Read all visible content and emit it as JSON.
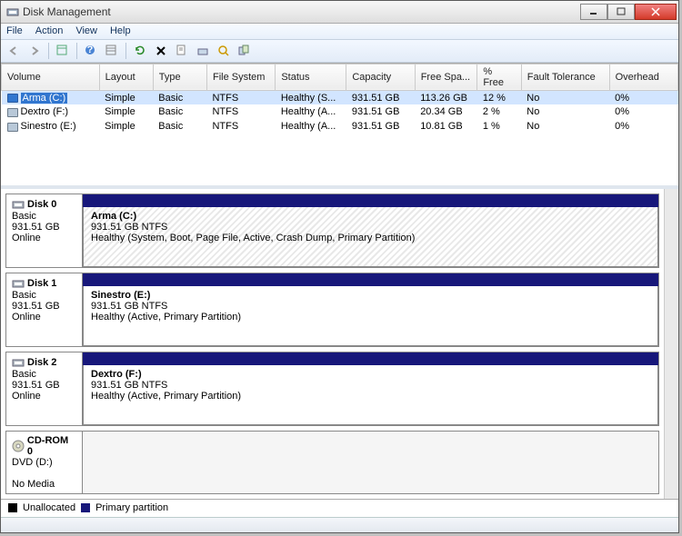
{
  "title": "Disk Management",
  "menu": {
    "file": "File",
    "action": "Action",
    "view": "View",
    "help": "Help"
  },
  "columns": [
    "Volume",
    "Layout",
    "Type",
    "File System",
    "Status",
    "Capacity",
    "Free Spa...",
    "% Free",
    "Fault Tolerance",
    "Overhead"
  ],
  "volumes": [
    {
      "name": "Arma (C:)",
      "layout": "Simple",
      "type": "Basic",
      "fs": "NTFS",
      "status": "Healthy (S...",
      "capacity": "931.51 GB",
      "free": "113.26 GB",
      "pct": "12 %",
      "ft": "No",
      "oh": "0%",
      "selected": true
    },
    {
      "name": "Dextro (F:)",
      "layout": "Simple",
      "type": "Basic",
      "fs": "NTFS",
      "status": "Healthy (A...",
      "capacity": "931.51 GB",
      "free": "20.34 GB",
      "pct": "2 %",
      "ft": "No",
      "oh": "0%",
      "selected": false
    },
    {
      "name": "Sinestro (E:)",
      "layout": "Simple",
      "type": "Basic",
      "fs": "NTFS",
      "status": "Healthy (A...",
      "capacity": "931.51 GB",
      "free": "10.81 GB",
      "pct": "1 %",
      "ft": "No",
      "oh": "0%",
      "selected": false
    }
  ],
  "disks": [
    {
      "label": "Disk 0",
      "type": "Basic",
      "size": "931.51 GB",
      "state": "Online",
      "vol": {
        "name": "Arma  (C:)",
        "info": "931.51 GB NTFS",
        "health": "Healthy (System, Boot, Page File, Active, Crash Dump, Primary Partition)",
        "hatched": true
      }
    },
    {
      "label": "Disk 1",
      "type": "Basic",
      "size": "931.51 GB",
      "state": "Online",
      "vol": {
        "name": "Sinestro  (E:)",
        "info": "931.51 GB NTFS",
        "health": "Healthy (Active, Primary Partition)",
        "hatched": false
      }
    },
    {
      "label": "Disk 2",
      "type": "Basic",
      "size": "931.51 GB",
      "state": "Online",
      "vol": {
        "name": "Dextro  (F:)",
        "info": "931.51 GB NTFS",
        "health": "Healthy (Active, Primary Partition)",
        "hatched": false
      }
    },
    {
      "label": "CD-ROM 0",
      "type": "DVD (D:)",
      "size": "",
      "state": "No Media",
      "vol": null
    }
  ],
  "legend": {
    "unallocated": "Unallocated",
    "primary": "Primary partition"
  }
}
